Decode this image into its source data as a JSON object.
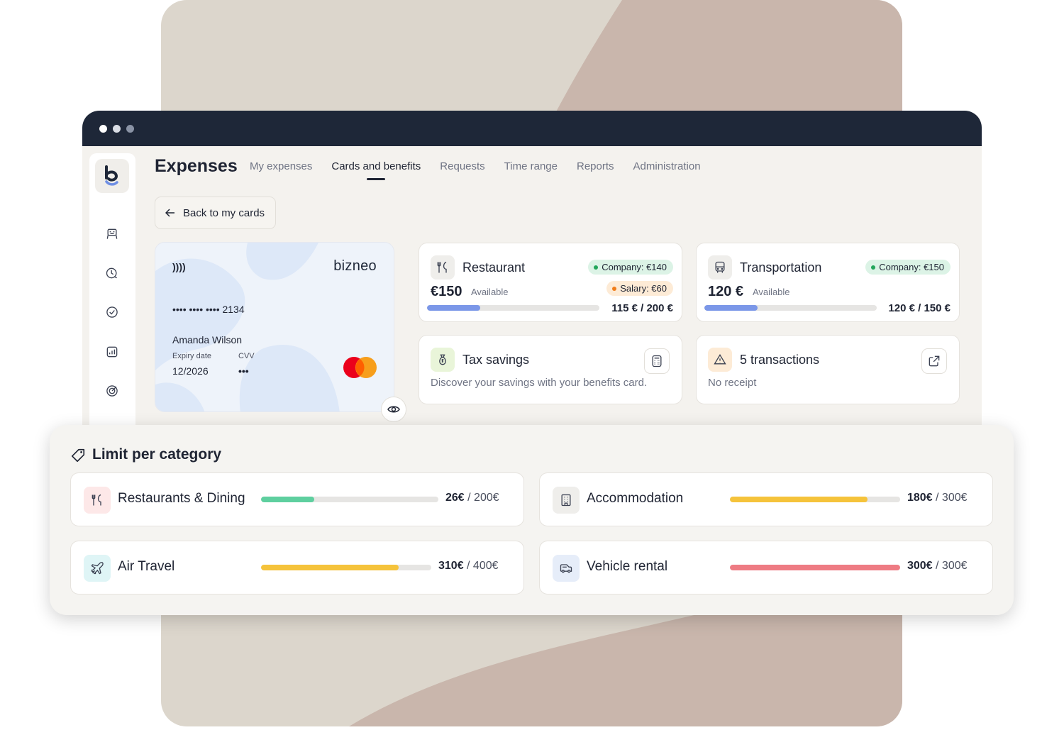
{
  "window": {
    "dots": [
      "#ffffff",
      "#d9dde5",
      "#8a93a5"
    ]
  },
  "sidebar": {
    "logo_text": "b",
    "icons": [
      "seat-icon",
      "clock-icon",
      "check-circle-icon",
      "chart-icon",
      "target-icon"
    ]
  },
  "header": {
    "title": "Expenses",
    "tabs": [
      {
        "label": "My expenses",
        "active": false
      },
      {
        "label": "Cards and benefits",
        "active": true
      },
      {
        "label": "Requests",
        "active": false
      },
      {
        "label": "Time range",
        "active": false
      },
      {
        "label": "Reports",
        "active": false
      },
      {
        "label": "Administration",
        "active": false
      }
    ]
  },
  "back_button": {
    "label": "Back to my cards",
    "icon": "arrow-left-icon"
  },
  "credit_card": {
    "brand": "bizneo",
    "number": "•••• •••• •••• 2134",
    "holder": "Amanda Wilson",
    "expiry_label": "Expiry date",
    "expiry_value": "12/2026",
    "cvv_label": "CVV",
    "cvv_value": "•••",
    "network_icon": "mastercard-icon"
  },
  "benefits": [
    {
      "title": "Restaurant",
      "icon": "fork-knife-icon",
      "amount": "€150",
      "available_label": "Available",
      "company_pill": "Company: €140",
      "salary_pill": "Salary: €60",
      "progress": 0.31,
      "ratio": "115 € / 200 €",
      "color": "#7b97e8"
    },
    {
      "title": "Transportation",
      "icon": "bus-icon",
      "amount": "120 €",
      "available_label": "Available",
      "company_pill": "Company: €150",
      "progress": 0.31,
      "ratio": "120 € / 150 €",
      "color": "#7b97e8"
    }
  ],
  "tax_savings": {
    "title": "Tax savings",
    "description": "Discover your savings with your benefits card.",
    "icon": "money-bag-icon",
    "action_icon": "calculator-icon"
  },
  "transactions": {
    "title": "5 transactions",
    "subtitle": "No receipt",
    "icon": "warning-icon",
    "action_icon": "external-link-icon"
  },
  "limits": {
    "title": "Limit per category",
    "items": [
      {
        "name": "Restaurants & Dining",
        "spent": "26€",
        "total": " / 200€",
        "progress": 0.3,
        "color": "#5ecf9f",
        "icon": "fork-knife-icon",
        "icon_bg": "#fde8e8"
      },
      {
        "name": "Accommodation",
        "spent": "180€",
        "total": " / 300€",
        "progress": 0.81,
        "color": "#f5c33b",
        "icon": "building-icon",
        "icon_bg": "#efeeeb"
      },
      {
        "name": "Air Travel",
        "spent": "310€",
        "total": " / 400€",
        "progress": 0.81,
        "color": "#f5c33b",
        "icon": "plane-icon",
        "icon_bg": "#dff5f6"
      },
      {
        "name": "Vehicle rental",
        "spent": "300€",
        "total": " / 300€",
        "progress": 1.0,
        "color": "#ee7b83",
        "icon": "car-icon",
        "icon_bg": "#e6edf9"
      }
    ]
  }
}
